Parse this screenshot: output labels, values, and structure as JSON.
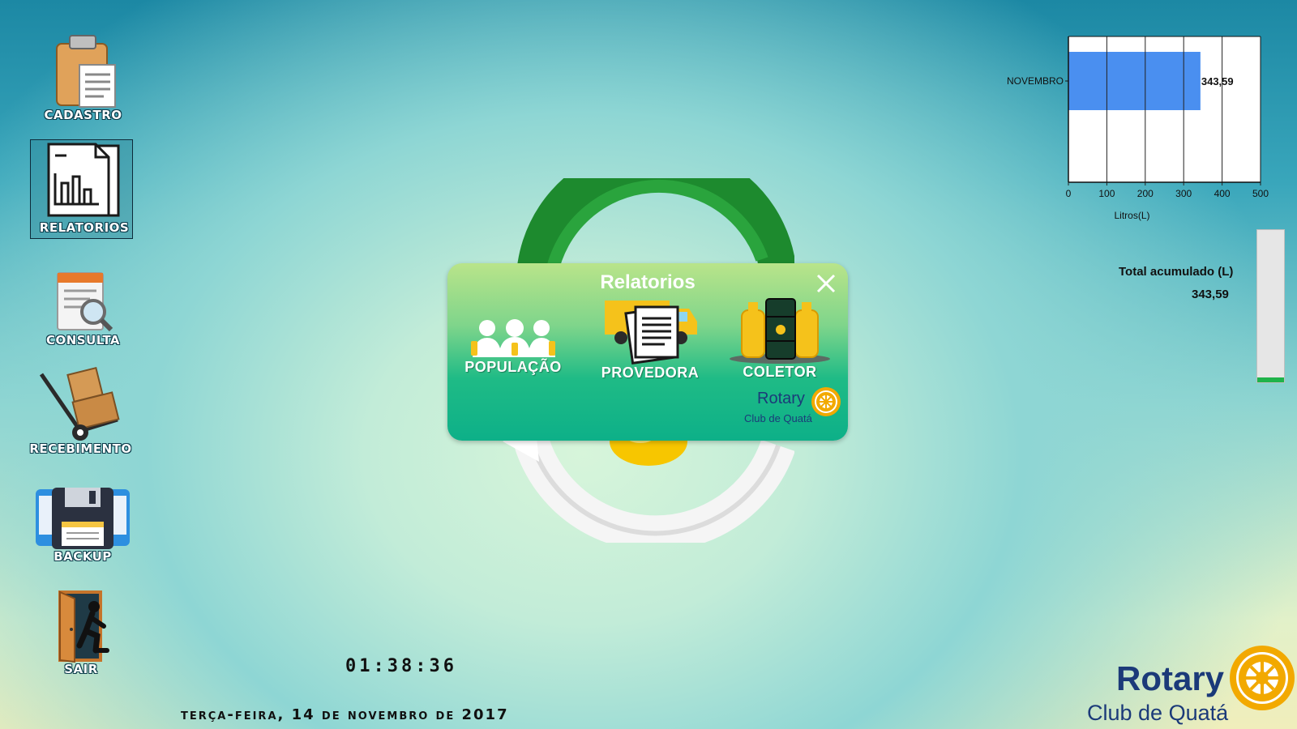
{
  "sidebar": {
    "items": [
      {
        "label": "CADASTRO",
        "icon": "clipboard-icon"
      },
      {
        "label": "RELATORIOS",
        "icon": "report-chart-icon"
      },
      {
        "label": "CONSULTA",
        "icon": "document-search-icon"
      },
      {
        "label": "RECEBIMENTO",
        "icon": "hand-truck-icon"
      },
      {
        "label": "BACKUP",
        "icon": "floppy-disk-icon"
      },
      {
        "label": "SAIR",
        "icon": "exit-door-icon"
      }
    ],
    "selected": "RELATORIOS"
  },
  "chart_data": {
    "type": "bar",
    "orientation": "horizontal",
    "categories": [
      "NOVEMBRO"
    ],
    "values": [
      343.59
    ],
    "data_labels": [
      "343,59"
    ],
    "xlabel": "Litros(L)",
    "ylabel": "",
    "xlim": [
      0,
      500
    ],
    "xticks": [
      "0",
      "100",
      "200",
      "300",
      "400",
      "500"
    ],
    "grid": true,
    "bar_color": "#4a8ff0"
  },
  "totals": {
    "title": "Total acumulado (L)",
    "value": "343,59",
    "gauge_fraction": 0.03,
    "gauge_color": "#1fb34a"
  },
  "clock": {
    "time": "01:38:36",
    "date": "terça-feira, 14 de novembro de 2017"
  },
  "modal": {
    "title": "Relatorios",
    "buttons": [
      {
        "label": "POPULAÇÃO",
        "icon": "people-icon"
      },
      {
        "label": "PROVEDORA",
        "icon": "truck-documents-icon"
      },
      {
        "label": "COLETOR",
        "icon": "oil-barrels-icon"
      }
    ],
    "logo": {
      "word": "Rotary",
      "sub": "Club de Quatá"
    }
  },
  "brand": {
    "word": "Rotary",
    "sub": "Club de Quatá",
    "color": "#1b3a79",
    "gold": "#f2a900"
  }
}
